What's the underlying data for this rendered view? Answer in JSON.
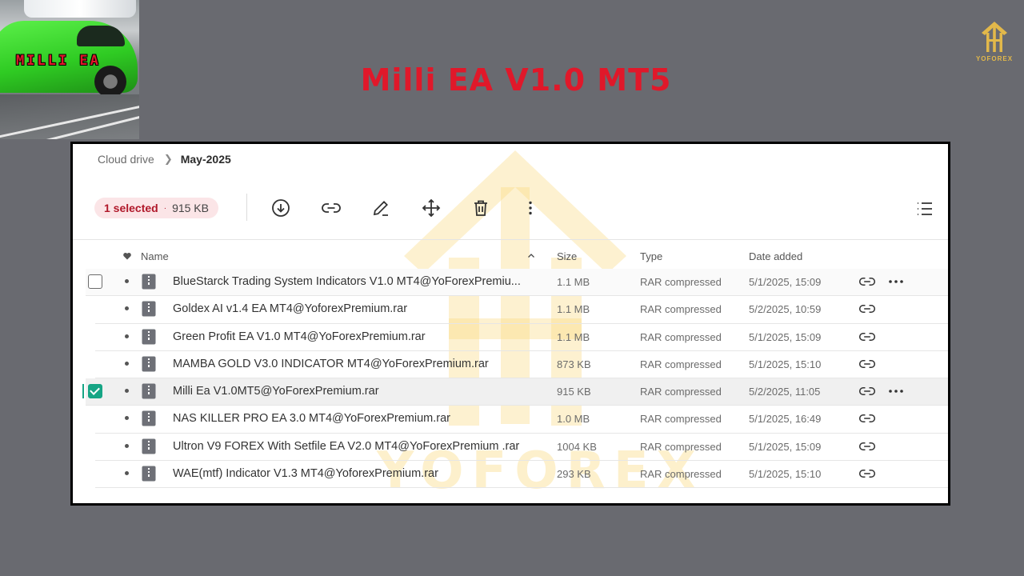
{
  "thumbnail": {
    "label": "MILLI EA"
  },
  "brand": {
    "name": "YOFOREX"
  },
  "title": "Milli EA V1.0 MT5",
  "breadcrumb": {
    "root": "Cloud drive",
    "current": "May-2025"
  },
  "selection": {
    "count_label": "1 selected",
    "separator": "·",
    "size": "915 KB"
  },
  "toolbar": {
    "download_icon": "download-icon",
    "link_icon": "link-icon",
    "rename_icon": "pencil-icon",
    "move_icon": "move-icon",
    "delete_icon": "trash-icon",
    "more_icon": "more-vertical-icon",
    "view_icon": "list-view-icon"
  },
  "columns": {
    "name": "Name",
    "size": "Size",
    "type": "Type",
    "date": "Date added"
  },
  "files": [
    {
      "name": "BlueStarck Trading System Indicators V1.0 MT4@YoForexPremiu...",
      "size": "1.1 MB",
      "type": "RAR compressed",
      "date": "5/1/2025, 15:09",
      "checkbox": true,
      "checked": false,
      "more": true
    },
    {
      "name": "Goldex AI v1.4 EA MT4@YoforexPremium.rar",
      "size": "1.1 MB",
      "type": "RAR compressed",
      "date": "5/2/2025, 10:59"
    },
    {
      "name": "Green Profit EA V1.0 MT4@YoForexPremium.rar",
      "size": "1.1 MB",
      "type": "RAR compressed",
      "date": "5/1/2025, 15:09"
    },
    {
      "name": "MAMBA GOLD V3.0 INDICATOR MT4@YoForexPremium.rar",
      "size": "873 KB",
      "type": "RAR compressed",
      "date": "5/1/2025, 15:10"
    },
    {
      "name": "Milli Ea V1.0MT5@YoForexPremium.rar",
      "size": "915 KB",
      "type": "RAR compressed",
      "date": "5/2/2025, 11:05",
      "checkbox": true,
      "checked": true,
      "more": true
    },
    {
      "name": "NAS KILLER PRO EA 3.0 MT4@YoForexPremium.rar",
      "size": "1.0 MB",
      "type": "RAR compressed",
      "date": "5/1/2025, 16:49"
    },
    {
      "name": "Ultron V9 FOREX With Setfile EA V2.0 MT4@YoForexPremium .rar",
      "size": "1004 KB",
      "type": "RAR compressed",
      "date": "5/1/2025, 15:09"
    },
    {
      "name": "WAE(mtf) Indicator V1.3 MT4@YoforexPremium.rar",
      "size": "293 KB",
      "type": "RAR compressed",
      "date": "5/1/2025, 15:10"
    }
  ],
  "watermark": {
    "text": "YOFOREX"
  },
  "colors": {
    "background": "#696a70",
    "title": "#e0182a",
    "brand_gold": "#e2b84a",
    "check": "#16a585",
    "pill_bg": "#fbe5e7",
    "pill_text": "#b0182a"
  }
}
